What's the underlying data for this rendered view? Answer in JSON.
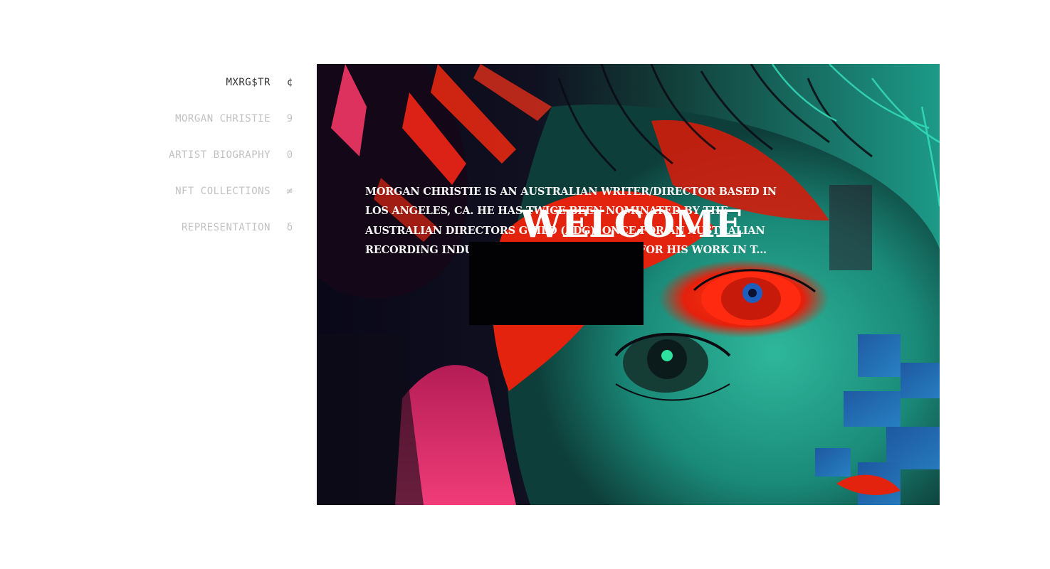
{
  "nav": {
    "items": [
      {
        "label": "MXRG$TR",
        "glyph": "¢",
        "active": true
      },
      {
        "label": "MORGAN CHRISTIE",
        "glyph": "9",
        "active": false
      },
      {
        "label": "ARTIST BIOGRAPHY",
        "glyph": "0",
        "active": false
      },
      {
        "label": "NFT COLLECTIONS",
        "glyph": "≠",
        "active": false
      },
      {
        "label": "REPRESENTATION",
        "glyph": "δ",
        "active": false
      }
    ]
  },
  "hero": {
    "bio": "MORGAN CHRISTIE IS AN AUSTRALIAN WRITER/DIRECTOR BASED IN LOS ANGELES, CA. HE HAS TWICE BEEN NOMINATED BY THE AUSTRALIAN DIRECTORS GUILD (ADG). ONCE FOR AN AUSTRALIAN RECORDING INDUSTRY AWARD (ARIA) AND ... FOR HIS WORK IN T...",
    "headline": "WELCOME"
  },
  "colors": {
    "nav_active": "#333333",
    "nav_inactive": "#c2c2c2",
    "hero_red": "#ff2a10",
    "hero_teal": "#1fb59a",
    "hero_magenta": "#e8336e",
    "hero_dark": "#07070f"
  }
}
